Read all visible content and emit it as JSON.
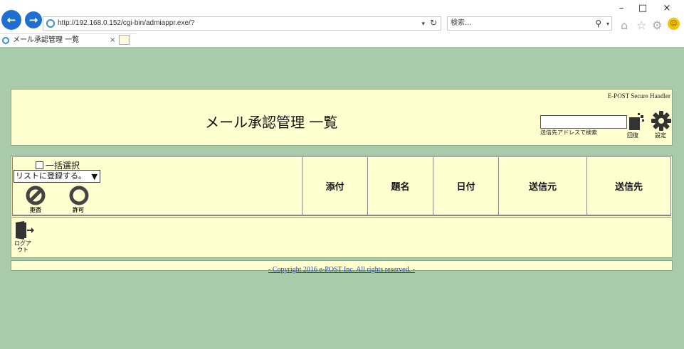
{
  "browser": {
    "url": "http://192.168.0.152/cgi-bin/admiappr.exe/?",
    "search_placeholder": "検索...",
    "tab_title": "メール承認管理 一覧",
    "back_glyph": "←",
    "forward_glyph": "→",
    "tab_close": "×",
    "window_controls": {
      "minimize": "–",
      "maximize": "□",
      "close": "×"
    }
  },
  "header": {
    "brand": "E-POST Secure Handler",
    "title": "メール承認管理 一覧",
    "address_search_value": "",
    "address_search_label": "送信先アドレスで検索",
    "recover_label": "回復",
    "settings_label": "設定"
  },
  "list": {
    "bulk_select_label": "一括選択",
    "action_select_value": "リストに登録する。",
    "reject_label": "拒否",
    "allow_label": "許可",
    "columns": [
      "添付",
      "題名",
      "日付",
      "送信元",
      "送信先"
    ],
    "logout_label": "ログアウト"
  },
  "footer": {
    "copyright": "- Copyright 2016 e-POST Inc. All rights reserved. -"
  },
  "colors": {
    "page_bg": "#a9cba9",
    "panel_bg": "#ffffd0",
    "link": "#1a3fc8",
    "ie_blue": "#1f6fd1"
  }
}
